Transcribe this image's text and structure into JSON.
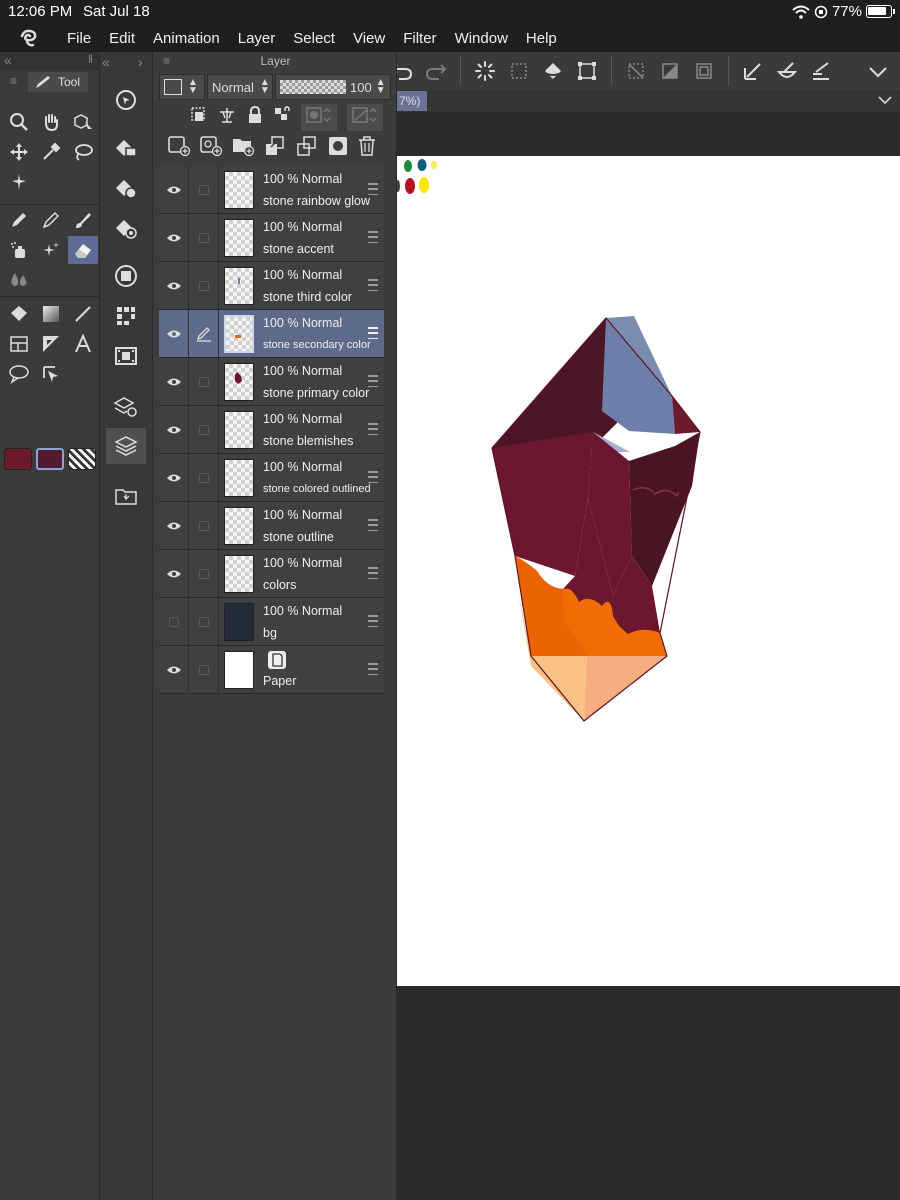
{
  "status_bar": {
    "time": "12:06 PM",
    "date": "Sat Jul 18",
    "battery": "77%"
  },
  "menu": [
    "File",
    "Edit",
    "Animation",
    "Layer",
    "Select",
    "View",
    "Filter",
    "Window",
    "Help"
  ],
  "tool_panel": {
    "tab_label": "Tool"
  },
  "canvas_tab": {
    "label": "7%)"
  },
  "layer_panel": {
    "title": "Layer",
    "blend_mode": "Normal",
    "opacity_value": "100",
    "layers": [
      {
        "meta": "100 % Normal",
        "name": "stone rainbow glow",
        "visible": true
      },
      {
        "meta": "100 % Normal",
        "name": "stone accent",
        "visible": true
      },
      {
        "meta": "100 % Normal",
        "name": "stone third color",
        "visible": true
      },
      {
        "meta": "100 % Normal",
        "name": "stone secondary color",
        "visible": true,
        "active": true
      },
      {
        "meta": "100 % Normal",
        "name": "stone primary color",
        "visible": true
      },
      {
        "meta": "100 % Normal",
        "name": "stone blemishes",
        "visible": true
      },
      {
        "meta": "100 % Normal",
        "name": "stone colored outlined",
        "visible": true
      },
      {
        "meta": "100 % Normal",
        "name": "stone outline",
        "visible": true
      },
      {
        "meta": "100 % Normal",
        "name": "colors",
        "visible": true
      },
      {
        "meta": "100 % Normal",
        "name": "bg",
        "visible": false
      },
      {
        "meta": "",
        "name": "Paper",
        "visible": true
      }
    ]
  },
  "colors": {
    "main_color": "#6e1a2b",
    "sub_color": "#561a30",
    "accent": "#5c6c94",
    "palette_dots": [
      "#1f8a3a",
      "#0e5d7a",
      "#f5e96a",
      "#b3121f",
      "#ffe600"
    ]
  }
}
